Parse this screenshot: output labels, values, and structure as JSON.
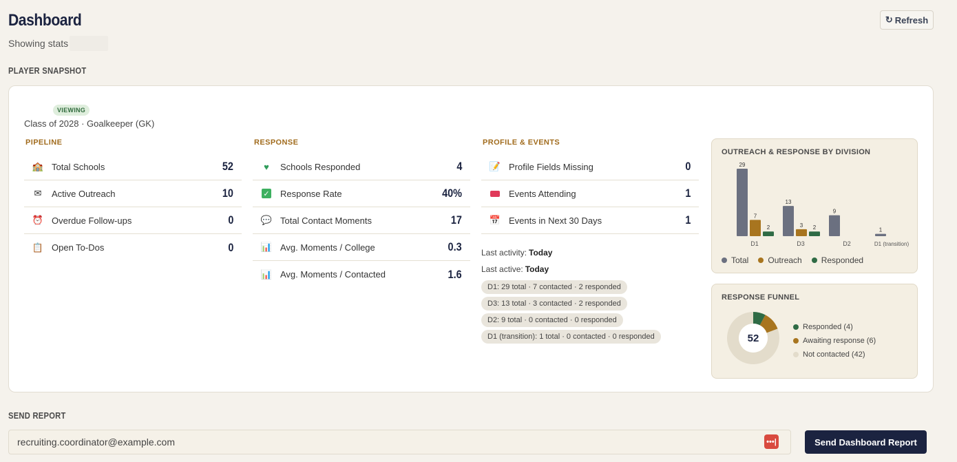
{
  "header": {
    "title": "Dashboard",
    "subtitle": "Showing stats",
    "refresh_label": "Refresh"
  },
  "snapshot": {
    "section_label": "PLAYER SNAPSHOT",
    "badge": "VIEWING",
    "player_meta": "Class of 2028 · Goalkeeper (GK)",
    "columns": [
      {
        "heading": "PIPELINE",
        "rows": [
          {
            "icon": "school-icon",
            "label": "Total Schools",
            "value": "52"
          },
          {
            "icon": "envelope-icon",
            "label": "Active Outreach",
            "value": "10"
          },
          {
            "icon": "alarm-clock-icon",
            "label": "Overdue Follow-ups",
            "value": "0"
          },
          {
            "icon": "clipboard-icon",
            "label": "Open To-Dos",
            "value": "0"
          }
        ]
      },
      {
        "heading": "RESPONSE",
        "rows": [
          {
            "icon": "heart-icon",
            "label": "Schools Responded",
            "value": "4"
          },
          {
            "icon": "checkmark-icon",
            "label": "Response Rate",
            "value": "40%"
          },
          {
            "icon": "speech-bubble-icon",
            "label": "Total Contact Moments",
            "value": "17"
          },
          {
            "icon": "bar-chart-icon",
            "label": "Avg. Moments / College",
            "value": "0.3"
          },
          {
            "icon": "bar-chart-icon",
            "label": "Avg. Moments / Contacted",
            "value": "1.6"
          }
        ]
      },
      {
        "heading": "PROFILE & EVENTS",
        "rows": [
          {
            "icon": "memo-icon",
            "label": "Profile Fields Missing",
            "value": "0"
          },
          {
            "icon": "ticket-icon",
            "label": "Events Attending",
            "value": "1"
          },
          {
            "icon": "calendar-icon",
            "label": "Events in Next 30 Days",
            "value": "1"
          }
        ]
      }
    ],
    "last_activity_label": "Last activity:",
    "last_activity_value": "Today",
    "last_active_label": "Last active:",
    "last_active_value": "Today",
    "division_pills": [
      "D1: 29 total · 7 contacted · 2 responded",
      "D3: 13 total · 3 contacted · 2 responded",
      "D2: 9 total · 0 contacted · 0 responded",
      "D1 (transition): 1 total · 0 contacted · 0 responded"
    ]
  },
  "colors": {
    "total": "#6b7080",
    "outreach": "#a8751f",
    "responded": "#2f6b45",
    "not_contacted": "#e3dccb",
    "accent_navy": "#1b2340"
  },
  "chart_data": [
    {
      "type": "bar",
      "title": "OUTREACH & RESPONSE BY DIVISION",
      "categories": [
        "D1",
        "D3",
        "D2",
        "D1 (transition)"
      ],
      "series": [
        {
          "name": "Total",
          "values": [
            29,
            13,
            9,
            1
          ]
        },
        {
          "name": "Outreach",
          "values": [
            7,
            3,
            0,
            0
          ]
        },
        {
          "name": "Responded",
          "values": [
            2,
            2,
            0,
            0
          ]
        }
      ],
      "ylim": [
        0,
        29
      ],
      "legend": "bottom-left",
      "grid": false
    },
    {
      "type": "pie",
      "title": "RESPONSE FUNNEL",
      "center_label": "52",
      "slices": [
        {
          "name": "Responded",
          "value": 4,
          "legend_text": "Responded (4)"
        },
        {
          "name": "Awaiting response",
          "value": 6,
          "legend_text": "Awaiting response (6)"
        },
        {
          "name": "Not contacted",
          "value": 42,
          "legend_text": "Not contacted (42)"
        }
      ]
    }
  ],
  "report": {
    "section_label": "SEND REPORT",
    "email_value": "recruiting.coordinator@example.com",
    "dots_label": "•••|",
    "send_label": "Send Dashboard Report"
  }
}
